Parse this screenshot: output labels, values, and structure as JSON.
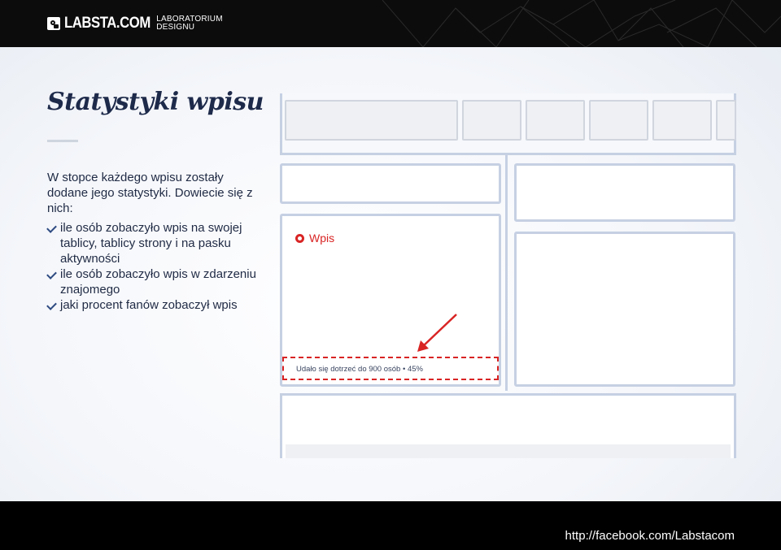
{
  "header": {
    "logo_text": "LABSTA.COM",
    "logo_sub_line1": "LABORATORIUM",
    "logo_sub_line2": "DESIGNU"
  },
  "slide": {
    "title": "Statystyki wpisu",
    "intro": "W stopce każdego wpisu zostały dodane jego statystyki. Dowiecie się z nich:",
    "features": [
      "ile osób zobaczyło wpis na swojej tablicy, tablicy strony i na pasku aktywności",
      "ile osób zobaczyło wpis w zdarzeniu znajomego",
      "jaki procent fanów zobaczył wpis"
    ]
  },
  "mockup": {
    "post_label": "Wpis",
    "stats_text": "Udało się dotrzeć do 900 osób • 45%"
  },
  "footer": {
    "url": "http://facebook.com/Labstacom"
  },
  "colors": {
    "accent_red": "#d92424",
    "title_navy": "#1e2a4a",
    "frame_blue": "#c6d0e3"
  }
}
